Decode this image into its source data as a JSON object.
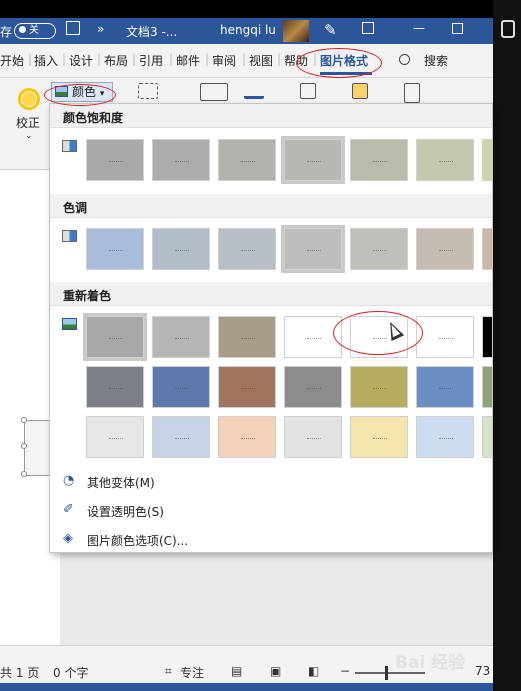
{
  "titlebar": {
    "save_partial": "存",
    "autosave_toggle": "关",
    "more": "»",
    "doc_name": "文档3 -...",
    "user_name": "hengqi lu"
  },
  "tabs": [
    "开始",
    "插入",
    "设计",
    "布局",
    "引用",
    "邮件",
    "审阅",
    "视图",
    "帮助",
    "图片格式"
  ],
  "search_label": "搜索",
  "ribbon": {
    "color_label": "颜色",
    "correct_label": "校正"
  },
  "panel": {
    "sections": [
      {
        "title": "颜色饱和度",
        "swatches": [
          "#a9a9a9",
          "#acacac",
          "#b1b1ae",
          "#b8b8b2",
          "#b9bcab",
          "#c3c7ab",
          "#cfd1a8"
        ],
        "selected": 3
      },
      {
        "title": "色调",
        "swatches": [
          "#a9bdda",
          "#b2bdc9",
          "#b8bfc4",
          "#bdbdbd",
          "#c0bfb9",
          "#c4bcb2",
          "#c9b7a7"
        ],
        "selected": 3
      },
      {
        "title": "重新着色",
        "swatches_row1": [
          "#a8a8a8",
          "#b6b6b6",
          "#aa9c8a",
          "#ffffff",
          "#ffffff",
          "#ffffff",
          "#000000"
        ],
        "swatches_row2": [
          "#7d8089",
          "#5d79ab",
          "#a1745d",
          "#8c8c8c",
          "#b7ad5f",
          "#6b8fc4",
          "#8ea27a"
        ],
        "swatches_row3": [
          "#e6e6e6",
          "#c7d4e8",
          "#f4d2b9",
          "#e2e2e2",
          "#f7e5b0",
          "#cddcf0",
          "#d6e3c9"
        ],
        "selected": 0
      }
    ],
    "menu": [
      {
        "label": "其他变体(M)",
        "icon": "palette-icon"
      },
      {
        "label": "设置透明色(S)",
        "icon": "transparent-pen-icon"
      },
      {
        "label": "图片颜色选项(C)...",
        "icon": "picture-color-options-icon"
      }
    ]
  },
  "status": {
    "pages": "共 1 页",
    "words": "0 个字",
    "focus": "专注",
    "zoom": "73"
  },
  "watermark": "Bai 经验"
}
